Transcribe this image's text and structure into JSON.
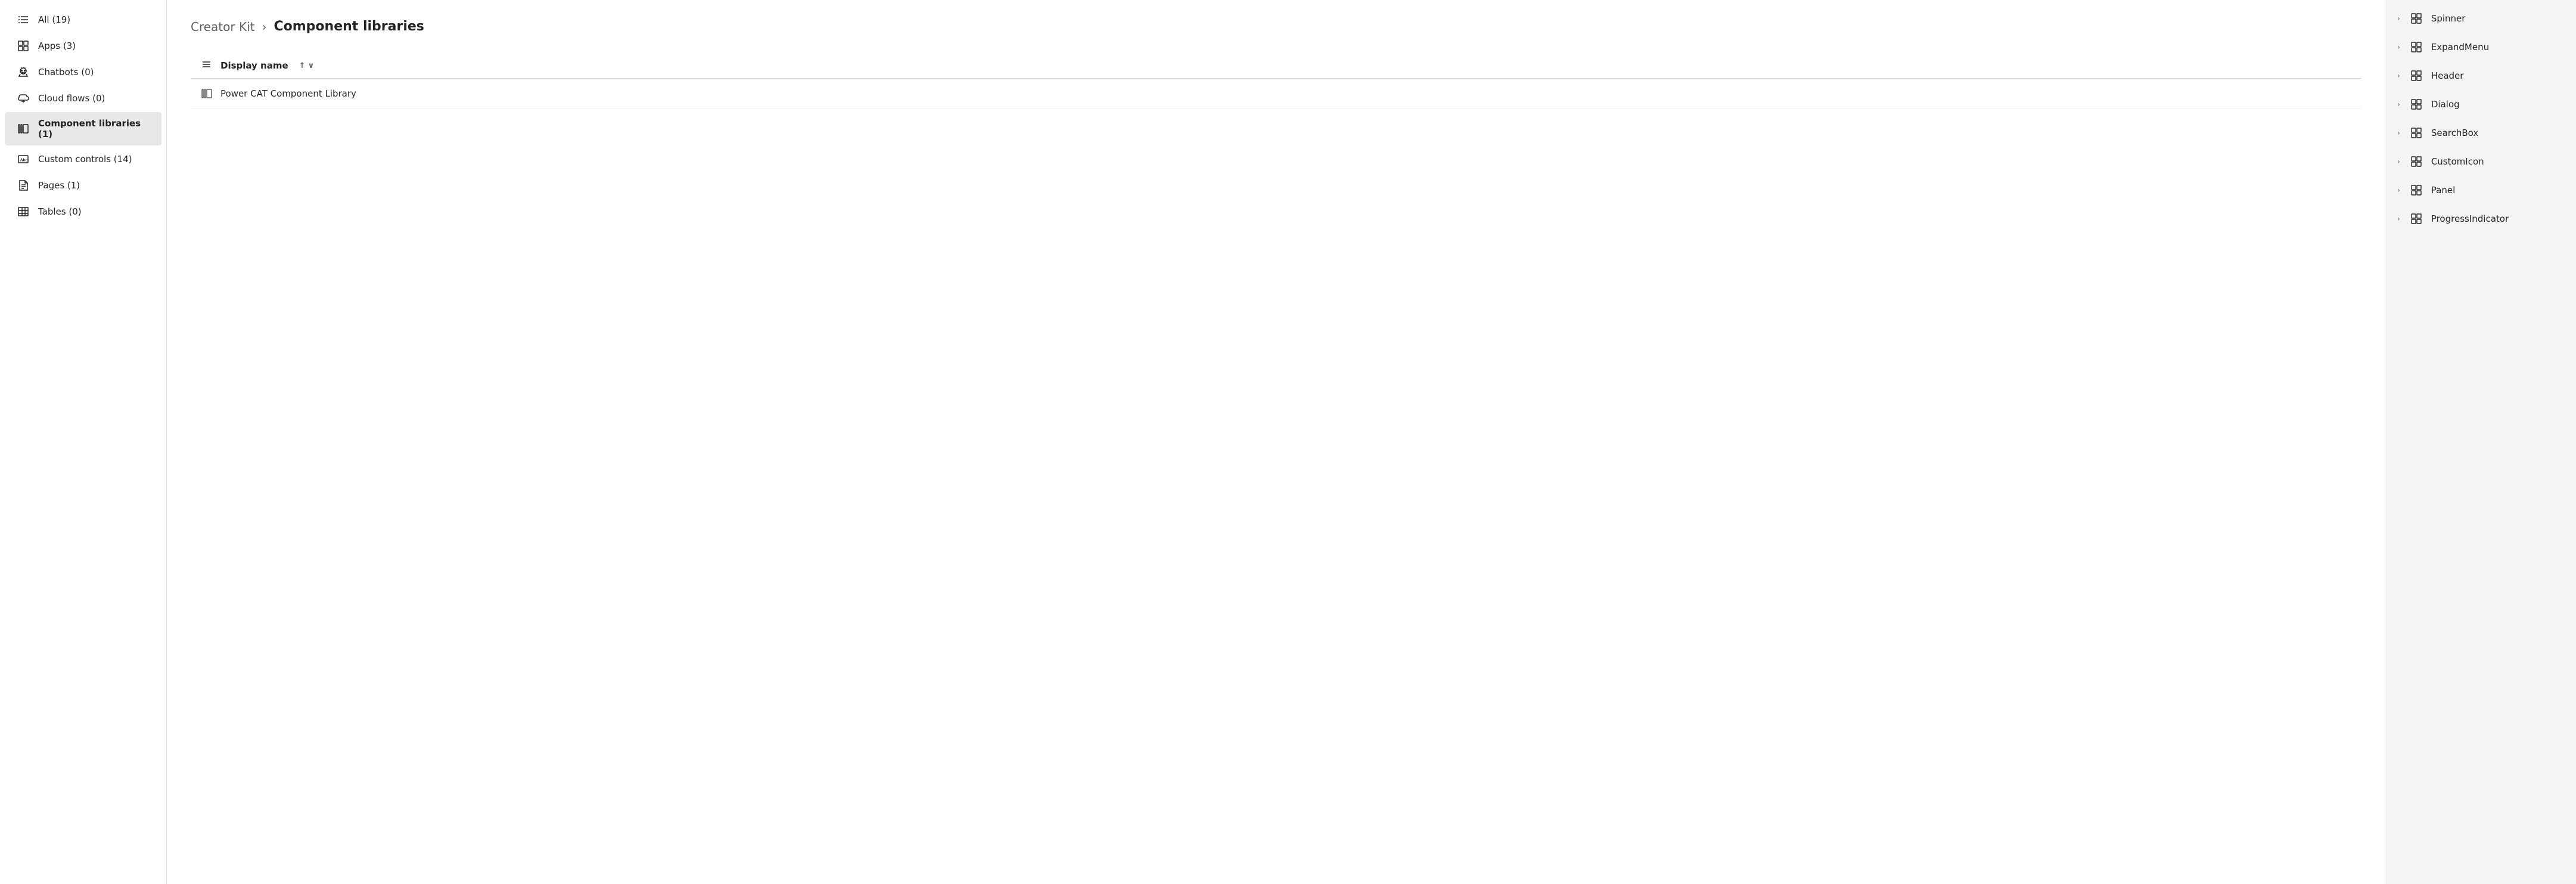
{
  "sidebar": {
    "items": [
      {
        "id": "all",
        "label": "All (19)",
        "icon": "list-icon",
        "active": false
      },
      {
        "id": "apps",
        "label": "Apps (3)",
        "icon": "apps-icon",
        "active": false
      },
      {
        "id": "chatbots",
        "label": "Chatbots (0)",
        "icon": "chatbot-icon",
        "active": false
      },
      {
        "id": "cloud-flows",
        "label": "Cloud flows (0)",
        "icon": "flow-icon",
        "active": false
      },
      {
        "id": "component-libraries",
        "label": "Component libraries (1)",
        "icon": "library-icon",
        "active": true
      },
      {
        "id": "custom-controls",
        "label": "Custom controls (14)",
        "icon": "abc-icon",
        "active": false
      },
      {
        "id": "pages",
        "label": "Pages (1)",
        "icon": "pages-icon",
        "active": false
      },
      {
        "id": "tables",
        "label": "Tables (0)",
        "icon": "tables-icon",
        "active": false
      }
    ]
  },
  "breadcrumb": {
    "parent": "Creator Kit",
    "separator": "›",
    "current": "Component libraries"
  },
  "table": {
    "column_header": "Display name",
    "sort_up": "↑",
    "sort_down": "∨",
    "rows": [
      {
        "name": "Power CAT Component Library"
      }
    ]
  },
  "right_sidebar": {
    "items": [
      {
        "label": "Spinner"
      },
      {
        "label": "ExpandMenu"
      },
      {
        "label": "Header"
      },
      {
        "label": "Dialog"
      },
      {
        "label": "SearchBox"
      },
      {
        "label": "CustomIcon"
      },
      {
        "label": "Panel"
      },
      {
        "label": "ProgressIndicator"
      }
    ]
  }
}
